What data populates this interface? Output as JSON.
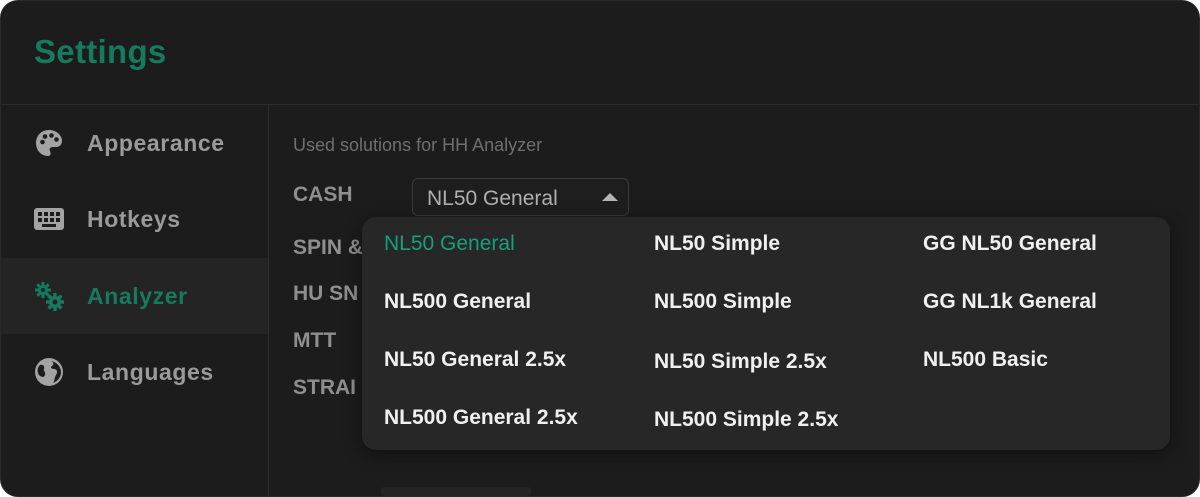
{
  "window": {
    "title": "Settings"
  },
  "colors": {
    "accent": "#157a5e",
    "selected_option": "#14a07a",
    "background": "#1c1c1c"
  },
  "sidebar": {
    "items": [
      {
        "label": "Appearance",
        "icon": "palette-icon",
        "active": false
      },
      {
        "label": "Hotkeys",
        "icon": "keyboard-icon",
        "active": false
      },
      {
        "label": "Analyzer",
        "icon": "gears-icon",
        "active": true
      },
      {
        "label": "Languages",
        "icon": "globe-icon",
        "active": false
      }
    ]
  },
  "analyzer": {
    "caption": "Used solutions for HH Analyzer",
    "rows": [
      {
        "label": "CASH"
      },
      {
        "label": "SPIN &"
      },
      {
        "label": "HU SN"
      },
      {
        "label": "MTT"
      },
      {
        "label": "STRAI"
      }
    ],
    "cash_select": {
      "value": "NL50 General"
    },
    "dropdown_options": [
      {
        "label": "NL50 General",
        "selected": true
      },
      {
        "label": "NL50 Simple",
        "selected": false
      },
      {
        "label": "GG NL50 General",
        "selected": false
      },
      {
        "label": "NL500 General",
        "selected": false
      },
      {
        "label": "NL500 Simple",
        "selected": false
      },
      {
        "label": "GG NL1k General",
        "selected": false
      },
      {
        "label": "NL50 General 2.5x",
        "selected": false
      },
      {
        "label": "NL50 Simple 2.5x",
        "selected": false
      },
      {
        "label": "NL500 Basic",
        "selected": false
      },
      {
        "label": "NL500 General 2.5x",
        "selected": false
      },
      {
        "label": "NL500 Simple 2.5x",
        "selected": false
      }
    ]
  }
}
